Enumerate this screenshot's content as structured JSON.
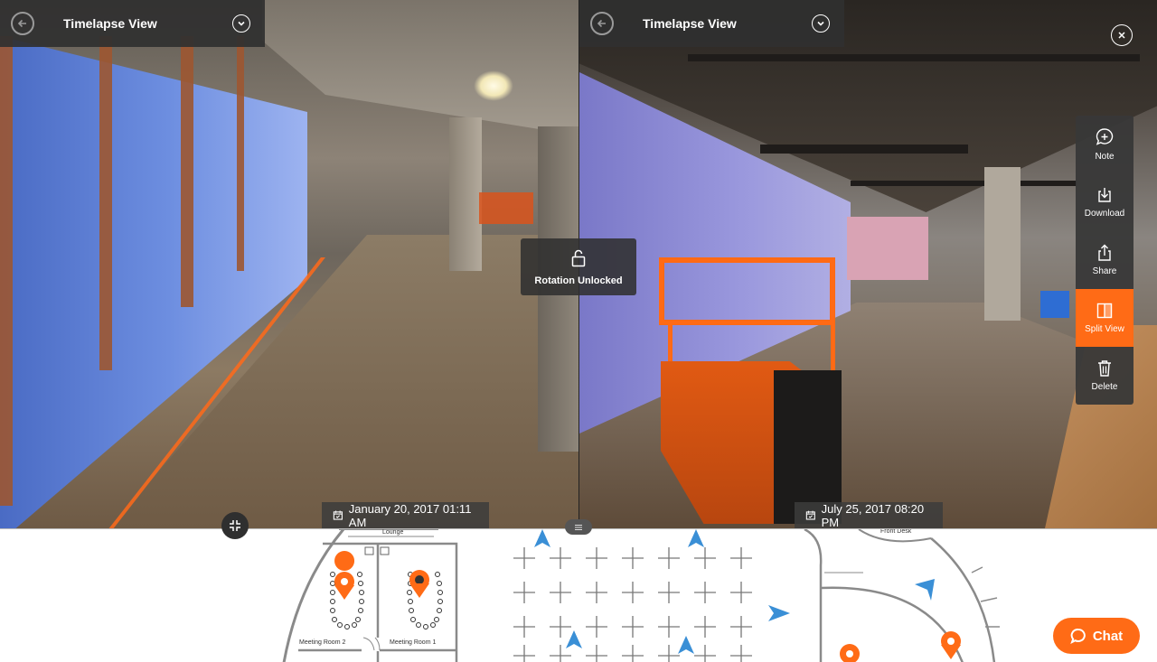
{
  "header_left": {
    "title": "Timelapse View"
  },
  "header_right": {
    "title": "Timelapse View"
  },
  "rotation": {
    "label": "Rotation Unlocked"
  },
  "dates": {
    "left": "January 20, 2017 01:11 AM",
    "right": "July 25, 2017 08:20 PM"
  },
  "toolbar": {
    "items": [
      {
        "label": "Note",
        "icon": "note-icon"
      },
      {
        "label": "Download",
        "icon": "download-icon"
      },
      {
        "label": "Share",
        "icon": "share-icon"
      },
      {
        "label": "Split View",
        "icon": "split-view-icon",
        "active": true
      },
      {
        "label": "Delete",
        "icon": "trash-icon"
      }
    ]
  },
  "floorplan": {
    "labels": {
      "lounge": "Lounge",
      "meeting_room_2": "Meeting Room 2",
      "meeting_room_1": "Meeting Room 1",
      "front_desk": "Front Desk"
    }
  },
  "chat": {
    "label": "Chat"
  },
  "colors": {
    "accent": "#ff6b16",
    "toolbar_bg": "#383838",
    "marker_blue": "#3a8fd6"
  }
}
